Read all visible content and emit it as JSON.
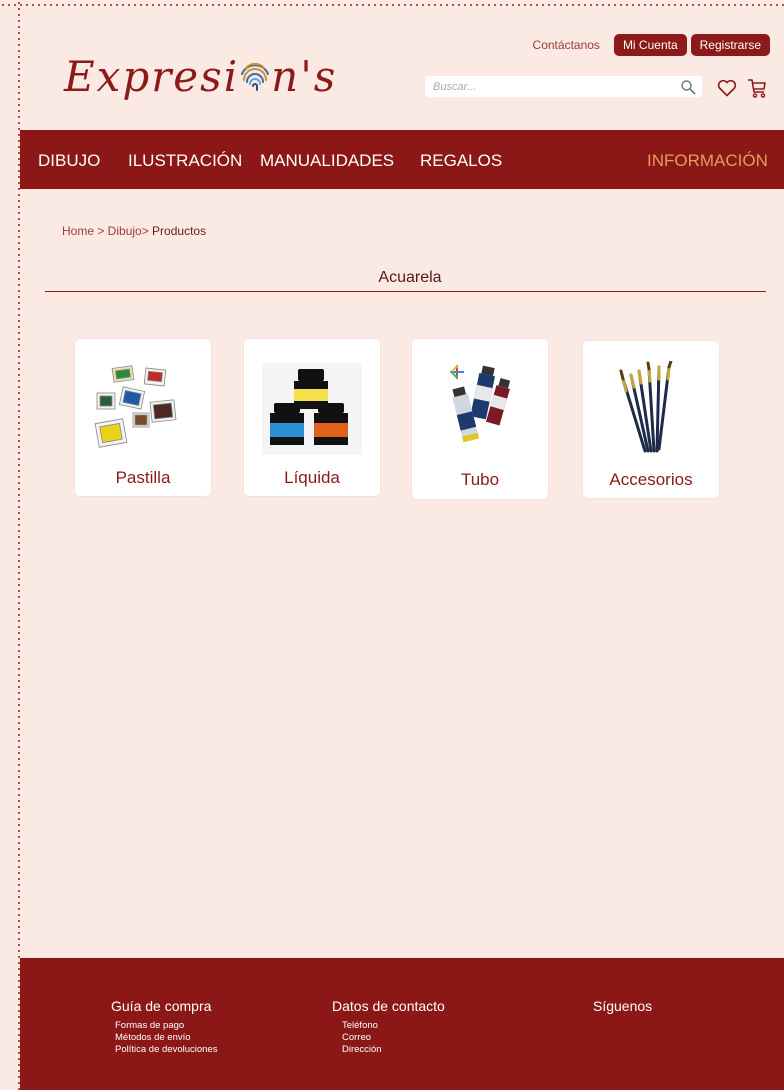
{
  "brand": {
    "logo_text_left": "Expresi",
    "logo_text_right": "n's"
  },
  "header": {
    "contact_label": "Contáctanos",
    "account_label": "Mi Cuenta",
    "register_label": "Registrarse",
    "search_placeholder": "Buscar..."
  },
  "nav": {
    "items": [
      "DIBUJO",
      "ILUSTRACIÓN",
      "MANUALIDADES",
      "REGALOS"
    ],
    "info_label": "INFORMACIÓN"
  },
  "breadcrumb": {
    "path": "Home > Dibujo> ",
    "current": "Productos"
  },
  "section": {
    "title": "Acuarela"
  },
  "products": [
    {
      "label": "Pastilla",
      "icon": "watercolor-pans-icon"
    },
    {
      "label": "Líquida",
      "icon": "ink-bottles-icon"
    },
    {
      "label": "Tubo",
      "icon": "paint-tubes-icon"
    },
    {
      "label": "Accesorios",
      "icon": "brushes-icon"
    }
  ],
  "footer": {
    "columns": [
      {
        "title": "Guía de compra",
        "items": [
          "Formas de pago",
          "Métodos de envío",
          "Política de devoluciones"
        ]
      },
      {
        "title": "Datos de contacto",
        "items": [
          "Teléfono",
          "Correo",
          "Dirección"
        ]
      },
      {
        "title": "Síguenos",
        "items": []
      }
    ]
  },
  "colors": {
    "primary": "#8c1717",
    "background": "#fbe9e4",
    "accent": "#e59c5e"
  }
}
